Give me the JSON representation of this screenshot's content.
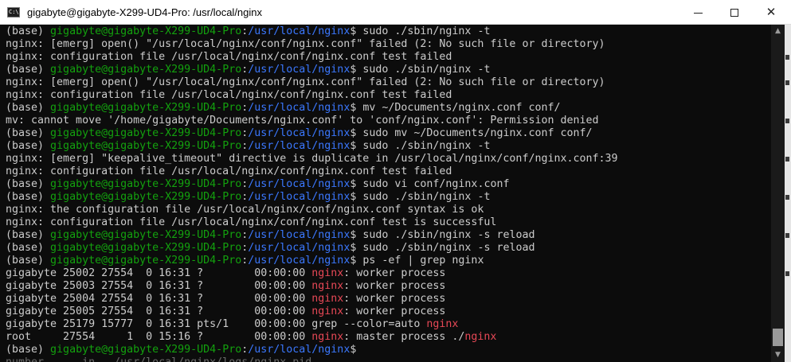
{
  "window": {
    "title": "gigabyte@gigabyte-X299-UD4-Pro: /usr/local/nginx",
    "icon": "console-icon",
    "icon_text": "C:\\",
    "minimize_label": "minimize",
    "maximize_label": "maximize",
    "close_label": "close"
  },
  "prompt": {
    "base": "(base) ",
    "userhost": "gigabyte@gigabyte-X299-UD4-Pro",
    "colon": ":",
    "path": "/usr/local/nginx",
    "dollar": "$ "
  },
  "colors": {
    "background": "#0c0c0c",
    "text": "#cccccc",
    "userhost": "#13a10e",
    "path": "#3b78ff",
    "highlight": "#e74856"
  },
  "terminal": {
    "lines": [
      {
        "type": "prompt",
        "cmd": "sudo ./sbin/nginx -t"
      },
      {
        "type": "text",
        "text": "nginx: [emerg] open() \"/usr/local/nginx/conf/nginx.conf\" failed (2: No such file or directory)"
      },
      {
        "type": "text",
        "text": "nginx: configuration file /usr/local/nginx/conf/nginx.conf test failed"
      },
      {
        "type": "prompt",
        "cmd": "sudo ./sbin/nginx -t"
      },
      {
        "type": "text",
        "text": "nginx: [emerg] open() \"/usr/local/nginx/conf/nginx.conf\" failed (2: No such file or directory)"
      },
      {
        "type": "text",
        "text": "nginx: configuration file /usr/local/nginx/conf/nginx.conf test failed"
      },
      {
        "type": "prompt",
        "cmd": "mv ~/Documents/nginx.conf conf/"
      },
      {
        "type": "text",
        "text": "mv: cannot move '/home/gigabyte/Documents/nginx.conf' to 'conf/nginx.conf': Permission denied"
      },
      {
        "type": "prompt",
        "cmd": "sudo mv ~/Documents/nginx.conf conf/"
      },
      {
        "type": "prompt",
        "cmd": "sudo ./sbin/nginx -t"
      },
      {
        "type": "text",
        "text": "nginx: [emerg] \"keepalive_timeout\" directive is duplicate in /usr/local/nginx/conf/nginx.conf:39"
      },
      {
        "type": "text",
        "text": "nginx: configuration file /usr/local/nginx/conf/nginx.conf test failed"
      },
      {
        "type": "prompt",
        "cmd": "sudo vi conf/nginx.conf"
      },
      {
        "type": "prompt",
        "cmd": "sudo ./sbin/nginx -t"
      },
      {
        "type": "text",
        "text": "nginx: the configuration file /usr/local/nginx/conf/nginx.conf syntax is ok"
      },
      {
        "type": "text",
        "text": "nginx: configuration file /usr/local/nginx/conf/nginx.conf test is successful"
      },
      {
        "type": "prompt",
        "cmd": "sudo ./sbin/nginx -s reload"
      },
      {
        "type": "prompt",
        "cmd": "sudo ./sbin/nginx -s reload"
      },
      {
        "type": "prompt",
        "cmd": "ps -ef | grep nginx"
      },
      {
        "type": "ps",
        "pre": "gigabyte 25002 27554  0 16:31 ?        00:00:00 ",
        "hl": "nginx",
        "post": ": worker process"
      },
      {
        "type": "ps",
        "pre": "gigabyte 25003 27554  0 16:31 ?        00:00:00 ",
        "hl": "nginx",
        "post": ": worker process"
      },
      {
        "type": "ps",
        "pre": "gigabyte 25004 27554  0 16:31 ?        00:00:00 ",
        "hl": "nginx",
        "post": ": worker process"
      },
      {
        "type": "ps",
        "pre": "gigabyte 25005 27554  0 16:31 ?        00:00:00 ",
        "hl": "nginx",
        "post": ": worker process"
      },
      {
        "type": "ps",
        "pre": "gigabyte 25179 15777  0 16:31 pts/1    00:00:00 grep --color=auto ",
        "hl": "nginx",
        "post": ""
      },
      {
        "type": "ps",
        "pre": "root     27554     1  0 15:16 ?        00:00:00 ",
        "hl": "nginx",
        "post": ": master process ./",
        "hl2": "nginx"
      },
      {
        "type": "prompt",
        "cmd": ""
      },
      {
        "type": "ghost",
        "text": "number      in   /usr/local/nginx/logs/nginx.pid"
      }
    ]
  }
}
